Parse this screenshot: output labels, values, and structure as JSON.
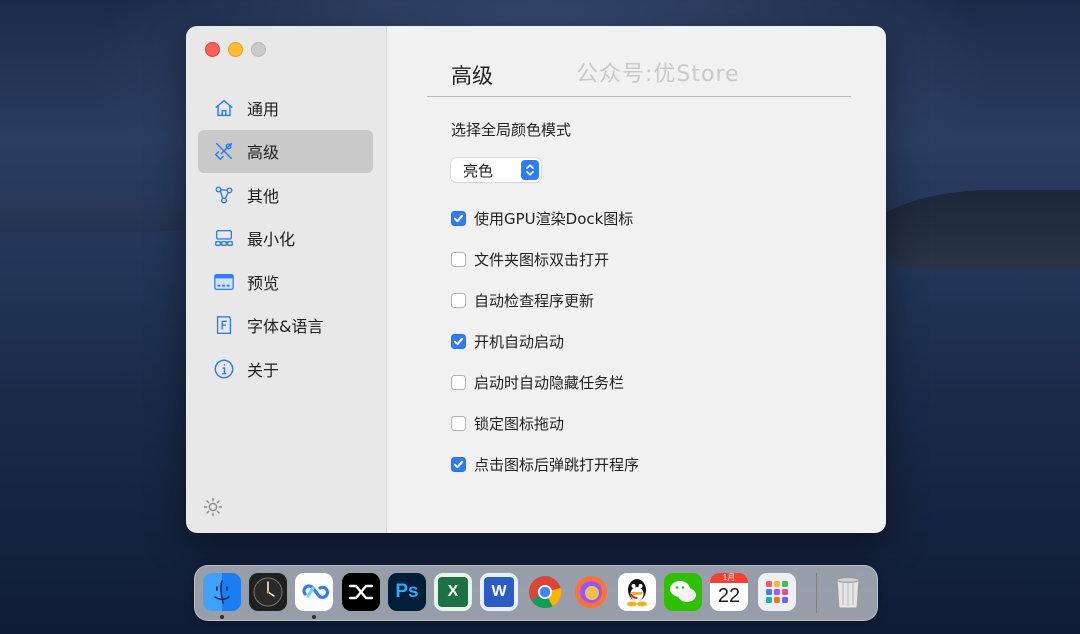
{
  "sidebar": {
    "items": [
      {
        "label": "通用",
        "icon": "home-icon"
      },
      {
        "label": "高级",
        "icon": "tools-icon"
      },
      {
        "label": "其他",
        "icon": "nodes-icon"
      },
      {
        "label": "最小化",
        "icon": "minimize-icon"
      },
      {
        "label": "预览",
        "icon": "preview-icon"
      },
      {
        "label": "字体&语言",
        "icon": "font-icon"
      },
      {
        "label": "关于",
        "icon": "info-icon"
      }
    ],
    "active_index": 1,
    "bottom_icon": "sun-icon"
  },
  "main": {
    "title": "高级",
    "watermark": "公众号:优Store",
    "color_mode_label": "选择全局颜色模式",
    "color_mode_value": "亮色",
    "options": [
      {
        "label": "使用GPU渲染Dock图标",
        "checked": true
      },
      {
        "label": "文件夹图标双击打开",
        "checked": false
      },
      {
        "label": "自动检查程序更新",
        "checked": false
      },
      {
        "label": "开机自动启动",
        "checked": true
      },
      {
        "label": "启动时自动隐藏任务栏",
        "checked": false
      },
      {
        "label": "锁定图标拖动",
        "checked": false
      },
      {
        "label": "点击图标后弹跳打开程序",
        "checked": true
      }
    ]
  },
  "dock": {
    "apps": [
      {
        "name": "finder-icon",
        "running": true
      },
      {
        "name": "clock-icon",
        "running": false
      },
      {
        "name": "baidu-netdisk-icon",
        "running": true
      },
      {
        "name": "capcut-icon",
        "running": false
      },
      {
        "name": "photoshop-icon",
        "text": "Ps",
        "running": false
      },
      {
        "name": "excel-icon",
        "text": "X",
        "running": false
      },
      {
        "name": "word-icon",
        "text": "W",
        "running": false
      },
      {
        "name": "chrome-icon",
        "running": false
      },
      {
        "name": "firefox-icon",
        "running": false
      },
      {
        "name": "qq-icon",
        "running": false
      },
      {
        "name": "wechat-icon",
        "running": false
      },
      {
        "name": "calendar-icon",
        "month": "1月",
        "day": "22",
        "running": false
      },
      {
        "name": "launchpad-icon",
        "running": false
      }
    ],
    "trash": "trash-icon"
  },
  "colors": {
    "accent": "#2f7cf6",
    "sidebar_bg": "#e8e8e8",
    "content_bg": "#f1f1f1",
    "active_row": "#c9c9c9"
  }
}
